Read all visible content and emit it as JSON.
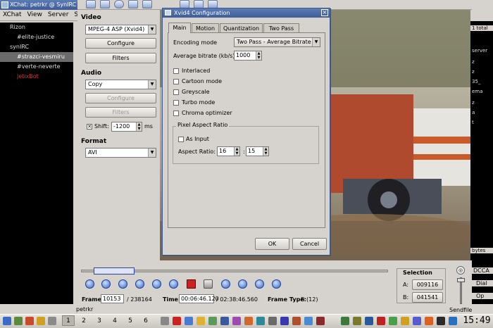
{
  "xchat": {
    "title": "XChat: petrkr @ SynIRC",
    "menu": [
      "XChat",
      "View",
      "Server",
      "S"
    ],
    "tree": [
      {
        "label": "Rizon",
        "indent": 0,
        "state": "normal"
      },
      {
        "label": "#elite-justice",
        "indent": 1,
        "state": "normal"
      },
      {
        "label": "synIRC",
        "indent": 0,
        "state": "normal"
      },
      {
        "label": "#strazci-vesmiru",
        "indent": 1,
        "state": "selected"
      },
      {
        "label": "#verte-neverte",
        "indent": 1,
        "state": "normal"
      },
      {
        "label": "jetixBot",
        "indent": 1,
        "state": "red"
      }
    ],
    "bottom_nick": "petrkr",
    "right_strip": [
      "1 total",
      "server",
      "z",
      "z",
      "35_",
      "ema",
      "z",
      "a",
      "t",
      "bytes",
      "DCCA",
      "Dial",
      "Op"
    ],
    "right_bottom": "Sendfile"
  },
  "avidemux": {
    "video": {
      "label": "Video",
      "codec": "MPEG-4 ASP (Xvid4)",
      "configure": "Configure",
      "filters": "Filters"
    },
    "audio": {
      "label": "Audio",
      "codec": "Copy",
      "configure": "Configure",
      "filters": "Filters",
      "shift_label": "Shift:",
      "shift_value": "-1200",
      "shift_unit": "ms"
    },
    "format": {
      "label": "Format",
      "value": "AVI"
    },
    "status": {
      "frame_label": "Frame:",
      "frame_value": "10153",
      "frame_total": "/ 238164",
      "time_label": "Time:",
      "time_value": "00:06:46.120",
      "time_total": "/ 02:38:46.560",
      "frame_type_label": "Frame Type:",
      "frame_type_value": "B (12)"
    },
    "selection": {
      "title": "Selection",
      "a_label": "A:",
      "a_value": "009116",
      "b_label": "B:",
      "b_value": "041541"
    }
  },
  "dialog": {
    "title": "Xvid4 Configuration",
    "tabs": [
      "Main",
      "Motion",
      "Quantization",
      "Two Pass"
    ],
    "active_tab": "Main",
    "encoding_mode_label": "Encoding mode",
    "encoding_mode_value": "Two Pass - Average Bitrate",
    "avg_bitrate_label": "Average bitrate (kb/s)",
    "avg_bitrate_value": "1000",
    "checkboxes": [
      {
        "label": "Interlaced",
        "checked": false
      },
      {
        "label": "Cartoon mode",
        "checked": false
      },
      {
        "label": "Greyscale",
        "checked": false
      },
      {
        "label": "Turbo mode",
        "checked": false
      },
      {
        "label": "Chroma optimizer",
        "checked": false
      }
    ],
    "par": {
      "legend": "Pixel Aspect Ratio",
      "as_input_label": "As Input",
      "as_input_checked": false,
      "aspect_label": "Aspect Ratio:",
      "aspect_num": "16",
      "aspect_sep": ":",
      "aspect_den": "15"
    },
    "ok": "OK",
    "cancel": "Cancel"
  },
  "taskbar": {
    "desktops": [
      "1",
      "2",
      "3",
      "4",
      "5",
      "6"
    ],
    "active_desktop": "1",
    "clock": "15:49"
  },
  "colors": {
    "titlebar": "#3e5d96",
    "window_bg": "#d6d3ce",
    "irc_bg": "#000000",
    "selected_channel": "#6b6b6b",
    "alert_channel": "#e03030"
  }
}
